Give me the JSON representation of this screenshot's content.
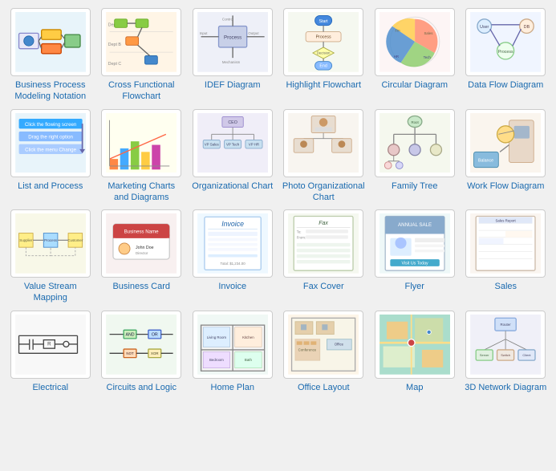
{
  "items": [
    {
      "id": "business-process",
      "label": "Business Process Modeling Notation",
      "bg": "#e8f4fa",
      "type": "bpmn"
    },
    {
      "id": "cross-functional",
      "label": "Cross Functional Flowchart",
      "bg": "#fff5e6",
      "type": "cross"
    },
    {
      "id": "idef-diagram",
      "label": "IDEF Diagram",
      "bg": "#eef0f8",
      "type": "idef"
    },
    {
      "id": "highlight-flowchart",
      "label": "Highlight Flowchart",
      "bg": "#f5f8f0",
      "type": "highlight"
    },
    {
      "id": "circular-diagram",
      "label": "Circular Diagram",
      "bg": "#fdf5f5",
      "type": "circular"
    },
    {
      "id": "data-flow-diagram",
      "label": "Data Flow Diagram",
      "bg": "#f0f5ff",
      "type": "dataflow"
    },
    {
      "id": "list-and-process",
      "label": "List and Process",
      "bg": "#e8f4fa",
      "type": "list"
    },
    {
      "id": "marketing-charts",
      "label": "Marketing Charts and Diagrams",
      "bg": "#fffff0",
      "type": "marketing"
    },
    {
      "id": "org-chart",
      "label": "Organizational Chart",
      "bg": "#f0eef8",
      "type": "org"
    },
    {
      "id": "photo-org-chart",
      "label": "Photo Organizational Chart",
      "bg": "#f8f5f0",
      "type": "photoorg"
    },
    {
      "id": "family-tree",
      "label": "Family Tree",
      "bg": "#f5f8ee",
      "type": "family"
    },
    {
      "id": "workflow-diagram",
      "label": "Work Flow Diagram",
      "bg": "#faf5ee",
      "type": "workflow"
    },
    {
      "id": "value-stream",
      "label": "Value Stream Mapping",
      "bg": "#f8f8e8",
      "type": "valuestream"
    },
    {
      "id": "business-card",
      "label": "Business Card",
      "bg": "#f8f0f0",
      "type": "bizcard"
    },
    {
      "id": "invoice",
      "label": "Invoice",
      "bg": "#eef8ff",
      "type": "invoice"
    },
    {
      "id": "fax-cover",
      "label": "Fax Cover",
      "bg": "#f5f8f0",
      "type": "fax"
    },
    {
      "id": "flyer",
      "label": "Flyer",
      "bg": "#eef8f8",
      "type": "flyer"
    },
    {
      "id": "sales",
      "label": "Sales",
      "bg": "#faf5f0",
      "type": "sales"
    },
    {
      "id": "electrical",
      "label": "Electrical",
      "bg": "#f8f8f8",
      "type": "electrical"
    },
    {
      "id": "circuits-logic",
      "label": "Circuits and Logic",
      "bg": "#f0f8f0",
      "type": "circuits"
    },
    {
      "id": "home-plan",
      "label": "Home Plan",
      "bg": "#f0f8f5",
      "type": "homeplan"
    },
    {
      "id": "office-layout",
      "label": "Office Layout",
      "bg": "#fdf5e8",
      "type": "office"
    },
    {
      "id": "map",
      "label": "Map",
      "bg": "#e8f8ee",
      "type": "map"
    },
    {
      "id": "3d-network",
      "label": "3D Network Diagram",
      "bg": "#f0f0f8",
      "type": "network3d"
    }
  ]
}
